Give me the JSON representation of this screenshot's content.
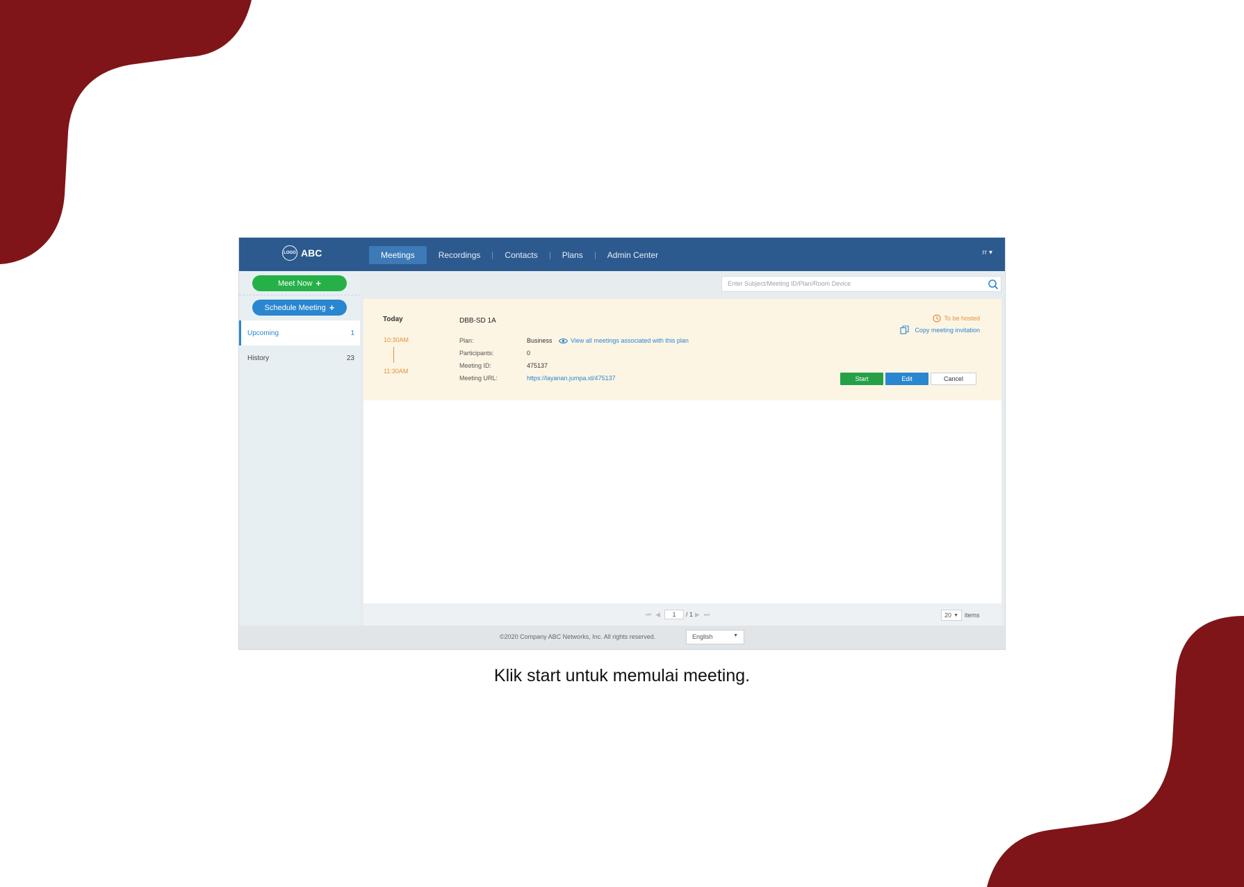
{
  "colors": {
    "accent_maroon": "#7f1519",
    "nav_bg": "#2c5a8f",
    "green": "#25a048",
    "blue": "#2b86d0",
    "orange": "#e09040"
  },
  "brand": {
    "logo_text": "LOGO",
    "name": "ABC"
  },
  "nav": {
    "items": [
      "Meetings",
      "Recordings",
      "Contacts",
      "Plans",
      "Admin Center"
    ],
    "active": "Meetings",
    "user": "rr"
  },
  "sidebar": {
    "meet_now": "Meet Now",
    "schedule": "Schedule Meeting",
    "items": [
      {
        "label": "Upcoming",
        "count": "1"
      },
      {
        "label": "History",
        "count": "23"
      }
    ]
  },
  "search": {
    "placeholder": "Enter Subject/Meeting ID/Plan/Room Device"
  },
  "meeting": {
    "day": "Today",
    "start": "10:30AM",
    "end": "11:30AM",
    "subject": "DBB-SD 1A",
    "plan_label": "Plan:",
    "plan_value": "Business",
    "view_all": "View all meetings associated with this plan",
    "participants_label": "Participants:",
    "participants_value": "0",
    "id_label": "Meeting ID:",
    "id_value": "475137",
    "url_label": "Meeting URL:",
    "url_value": "https://layanan.jumpa.id/475137",
    "status": "To be hosted",
    "copy_invitation": "Copy meeting invitation",
    "start_btn": "Start",
    "edit_btn": "Edit",
    "cancel_btn": "Cancel"
  },
  "pager": {
    "page": "1",
    "total": "/ 1",
    "page_size": "20",
    "items_label": "items"
  },
  "footer": {
    "copyright": "©2020 Company ABC Networks, Inc. All rights reserved.",
    "language": "English"
  },
  "caption": "Klik start untuk memulai meeting."
}
